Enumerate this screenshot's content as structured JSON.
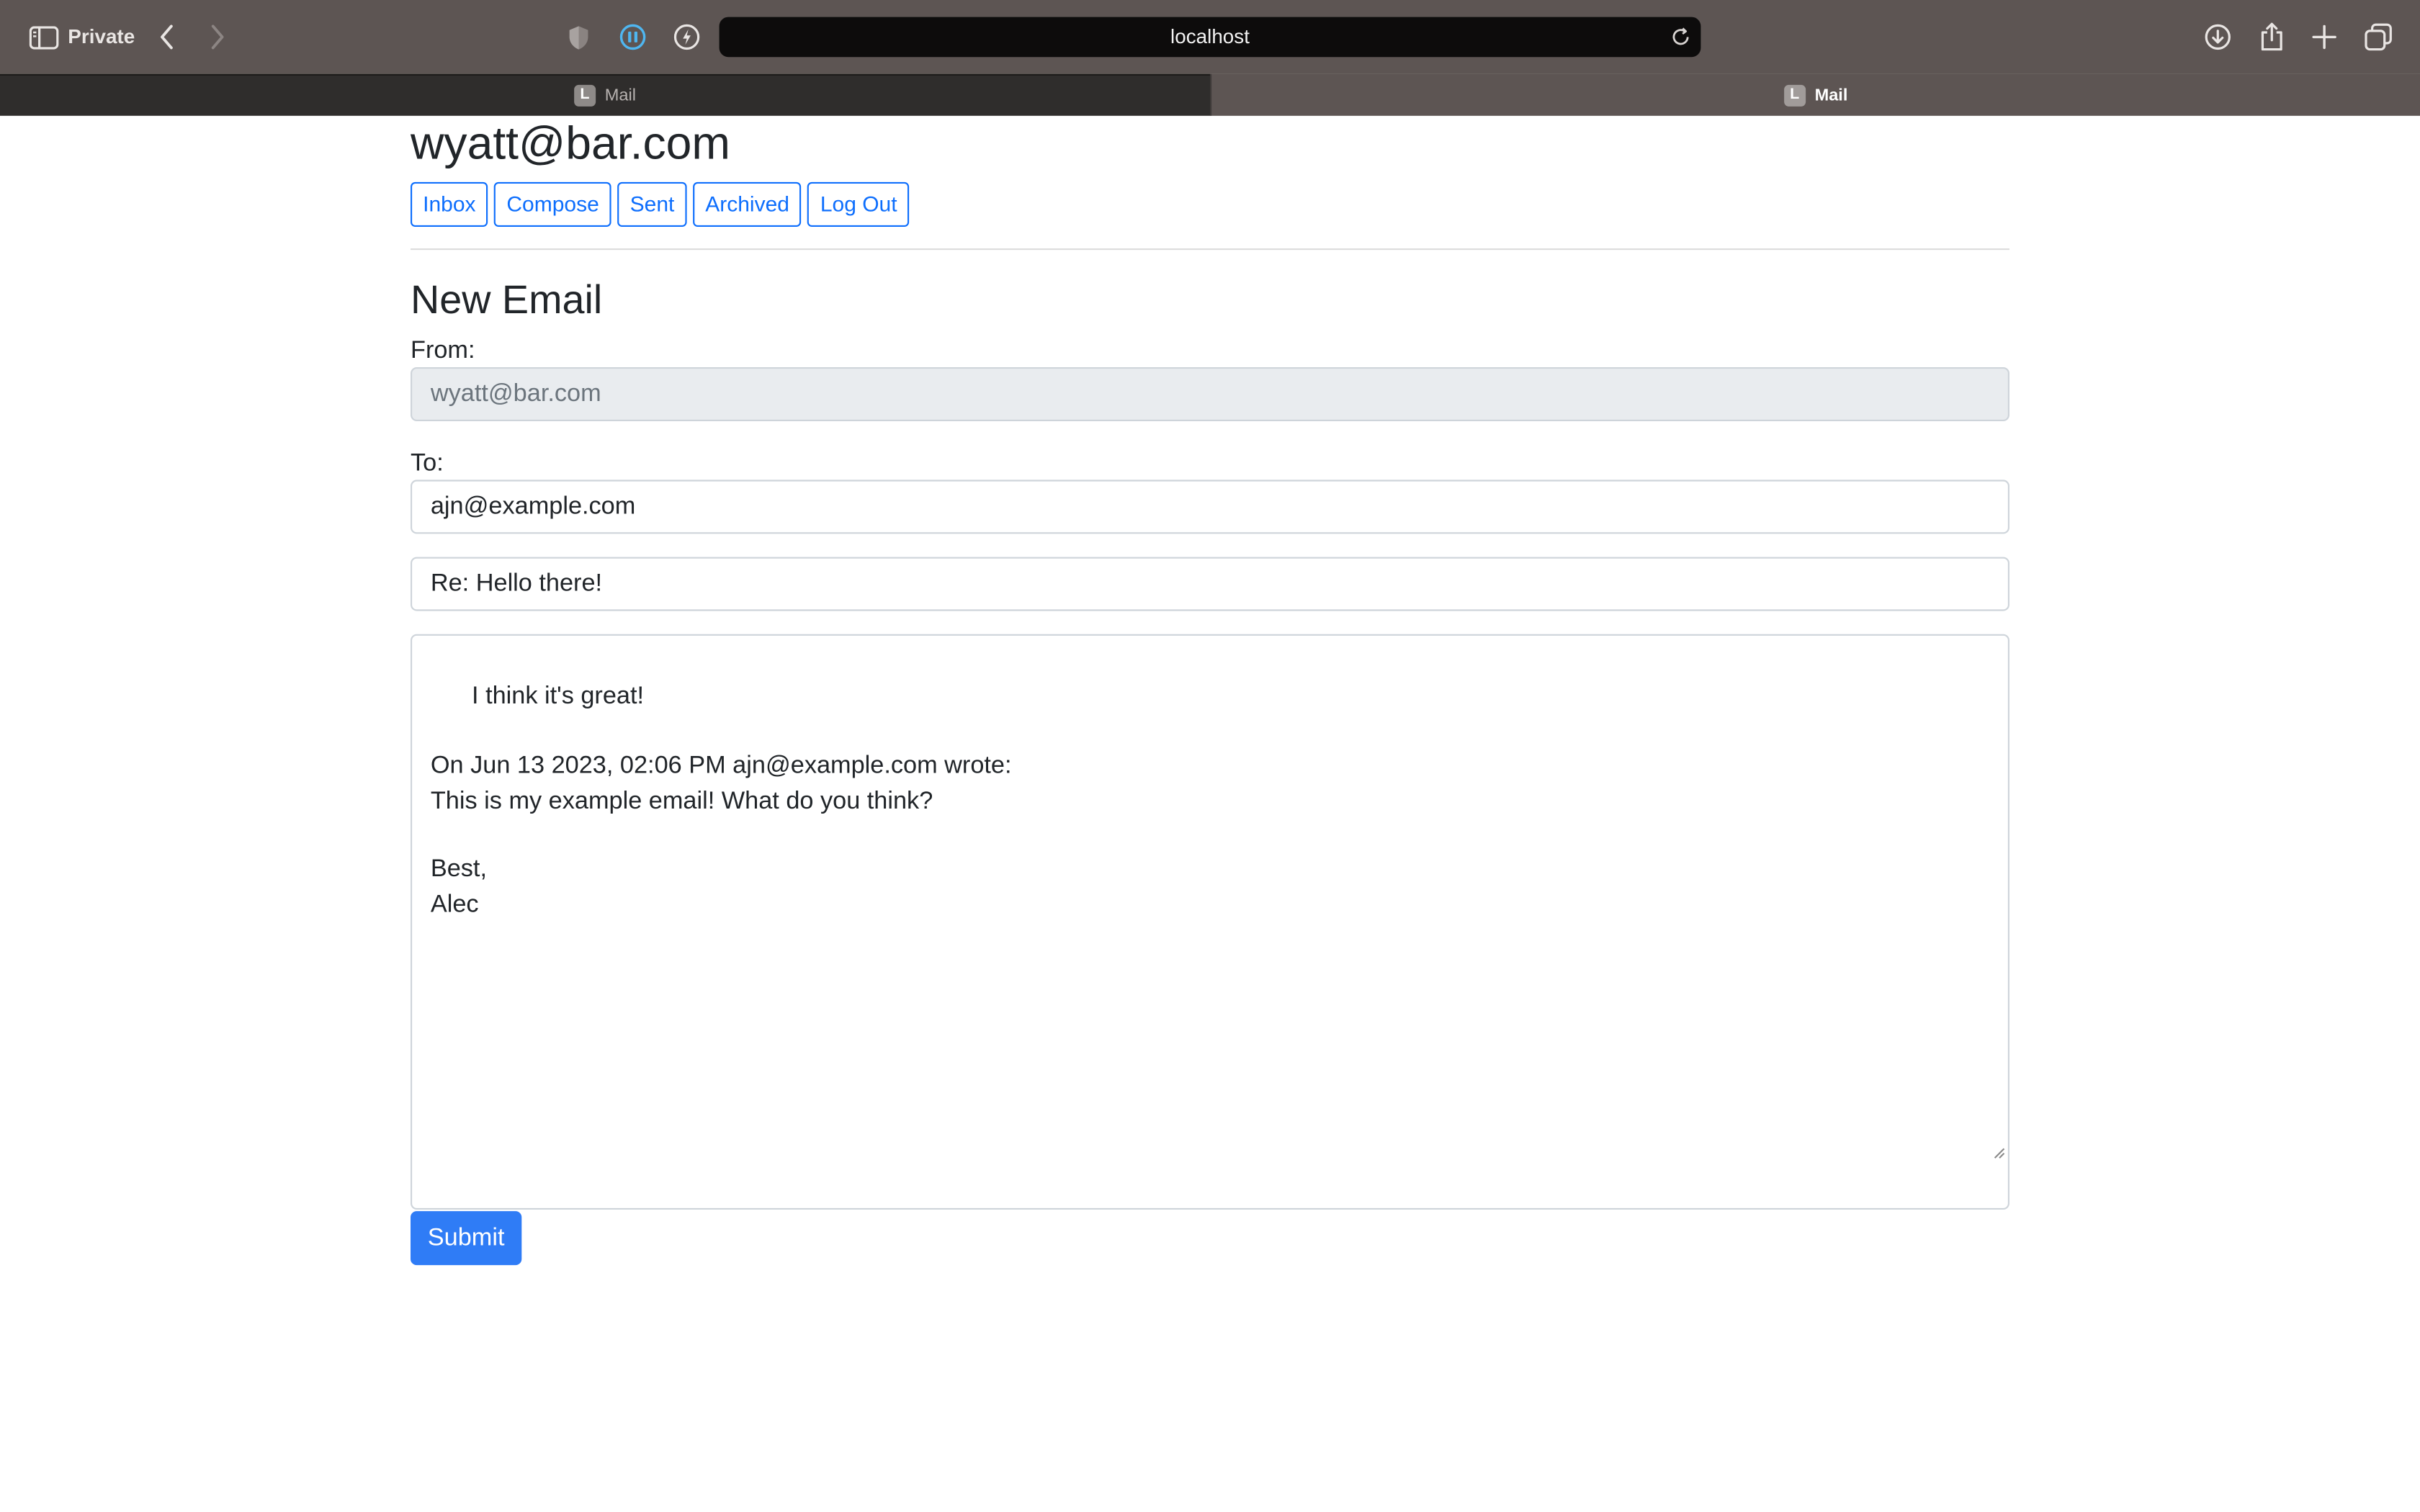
{
  "browser": {
    "private_label": "Private",
    "url": "localhost",
    "tabs": [
      {
        "label": "Mail",
        "favicon": "L",
        "active": false
      },
      {
        "label": "Mail",
        "favicon": "L",
        "active": true
      }
    ],
    "icons": {
      "sidebar": "sidebar-icon",
      "back": "chevron-left-icon",
      "forward": "chevron-right-icon",
      "privacy": "shield-icon",
      "pause": "pause-icon",
      "extension": "lightning-icon",
      "reload": "reload-icon",
      "downloads": "download-icon",
      "share": "share-icon",
      "new_tab": "plus-icon",
      "tab_overview": "tabs-overview-icon"
    }
  },
  "header": {
    "account": "wyatt@bar.com",
    "nav": [
      "Inbox",
      "Compose",
      "Sent",
      "Archived",
      "Log Out"
    ]
  },
  "compose": {
    "heading": "New Email",
    "from_label": "From:",
    "from_value": "wyatt@bar.com",
    "to_label": "To:",
    "to_value": "ajn@example.com",
    "subject_value": "Re: Hello there!",
    "body_value": "I think it's great!\n\nOn Jun 13 2023, 02:06 PM ajn@example.com wrote:\nThis is my example email! What do you think?\n\nBest,\nAlec",
    "submit_label": "Submit"
  },
  "colors": {
    "chrome": "#5d5553",
    "primary": "#0d6efd",
    "submit": "#2f7cf6"
  }
}
